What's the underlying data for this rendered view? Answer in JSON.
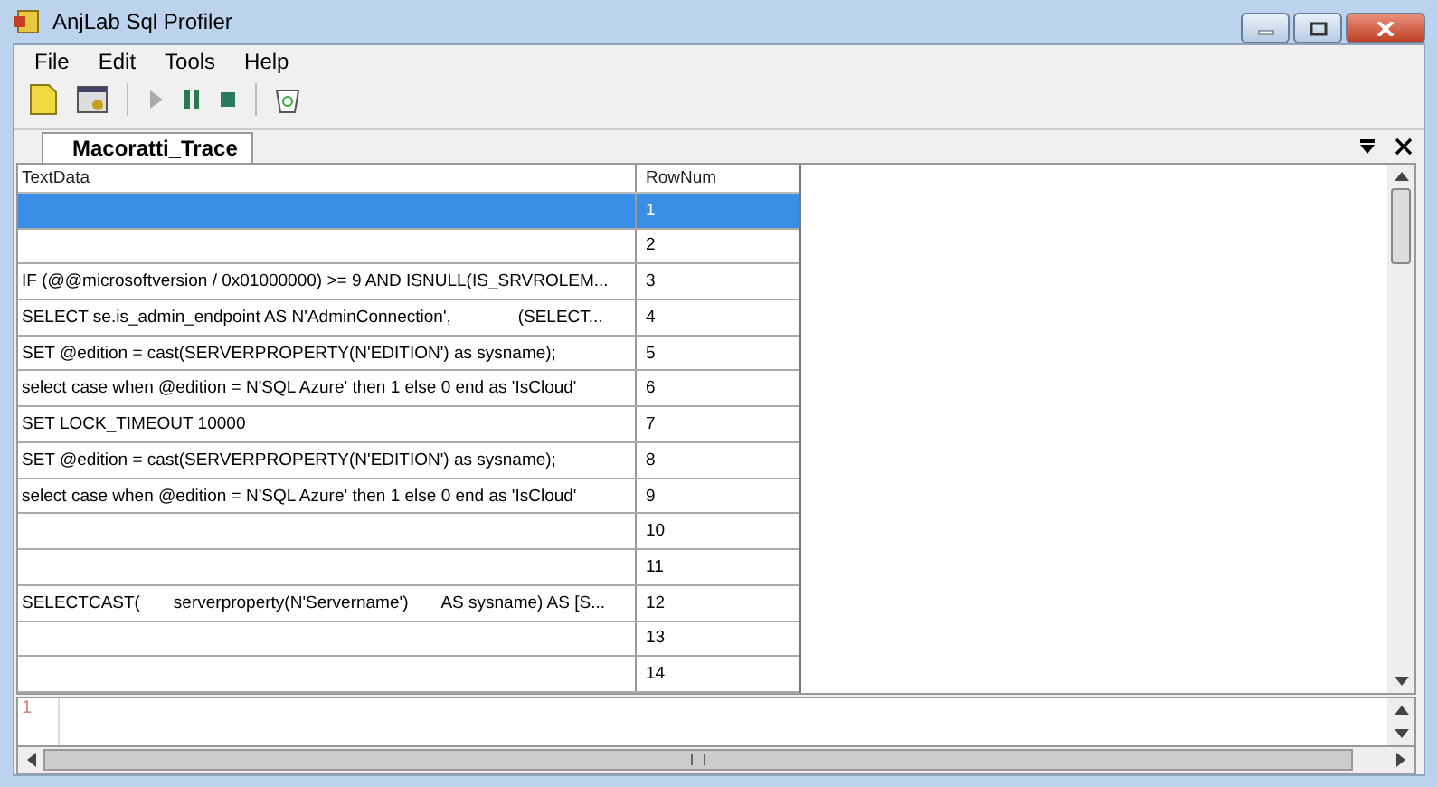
{
  "window": {
    "title": "AnjLab Sql Profiler"
  },
  "menu": [
    "File",
    "Edit",
    "Tools",
    "Help"
  ],
  "tabs": [
    {
      "label": "Macoratti_Trace",
      "selected": true
    }
  ],
  "table": {
    "columns": [
      "TextData",
      "RowNum"
    ],
    "rows": [
      {
        "text_data": "",
        "row_num": "1",
        "selected": true
      },
      {
        "text_data": "",
        "row_num": "2",
        "selected": false
      },
      {
        "text_data": "IF (@@microsoftversion / 0x01000000) >= 9 AND ISNULL(IS_SRVROLEM...",
        "row_num": "3",
        "selected": false
      },
      {
        "text_data": "SELECT se.is_admin_endpoint AS N'AdminConnection',              (SELECT...",
        "row_num": "4",
        "selected": false
      },
      {
        "text_data": "SET @edition = cast(SERVERPROPERTY(N'EDITION') as sysname);",
        "row_num": "5",
        "selected": false
      },
      {
        "text_data": "select case when @edition = N'SQL Azure' then 1 else 0 end as 'IsCloud'",
        "row_num": "6",
        "selected": false
      },
      {
        "text_data": "SET LOCK_TIMEOUT 10000",
        "row_num": "7",
        "selected": false
      },
      {
        "text_data": "SET @edition = cast(SERVERPROPERTY(N'EDITION') as sysname);",
        "row_num": "8",
        "selected": false
      },
      {
        "text_data": "select case when @edition = N'SQL Azure' then 1 else 0 end as 'IsCloud'",
        "row_num": "9",
        "selected": false
      },
      {
        "text_data": "",
        "row_num": "10",
        "selected": false
      },
      {
        "text_data": "",
        "row_num": "11",
        "selected": false
      },
      {
        "text_data": "SELECTCAST(       serverproperty(N'Servername')       AS sysname) AS [S...",
        "row_num": "12",
        "selected": false
      },
      {
        "text_data": "",
        "row_num": "13",
        "selected": false
      },
      {
        "text_data": "",
        "row_num": "14",
        "selected": false
      }
    ]
  },
  "editor": {
    "line_numbers": [
      "1"
    ]
  }
}
